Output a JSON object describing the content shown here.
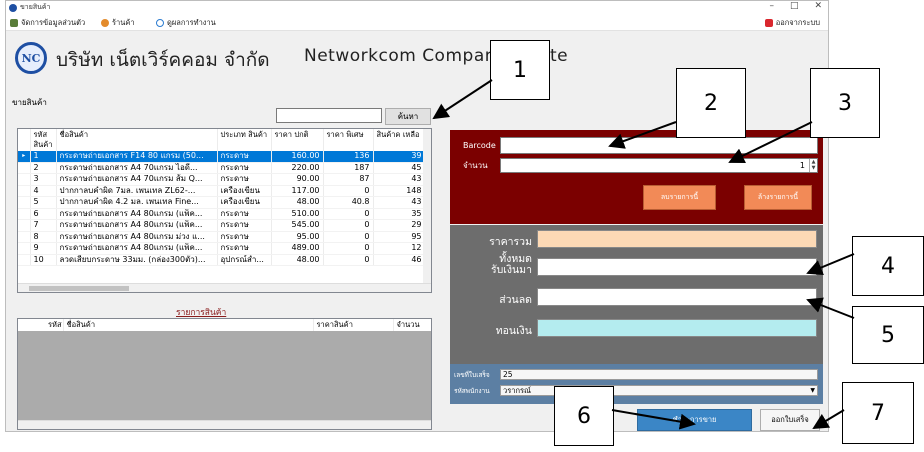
{
  "window": {
    "title": "ขายสินค้า",
    "controls": [
      "–",
      "□",
      "✕"
    ]
  },
  "menu": {
    "items": [
      "จัดการข้อมูลส่วนตัว",
      "ร้านค้า",
      "ดูผลการทำงาน"
    ],
    "logout": "ออกจากระบบ"
  },
  "company": {
    "logo_text": "NC",
    "name_th": "บริษัท เน็ตเวิร์คคอม จำกัด",
    "name_en": "Networkcom Company Limite"
  },
  "products": {
    "label": "ขายสินค้า",
    "search_button": "ค้นหา",
    "search_value": "",
    "columns": [
      "รหัส สินค้า",
      "ชื่อสินค้า",
      "ประเภท สินค้า",
      "ราคา ปกติ",
      "ราคา พิเศษ",
      "สินค้าค เหลือ"
    ],
    "rows": [
      [
        "1",
        "กระดาษถ่ายเอกสาร F14 80 แกรม (50...",
        "กระดาษ",
        "160.00",
        "136",
        "39"
      ],
      [
        "2",
        "กระดาษถ่ายเอกสาร A4 70แกรม ไอดี...",
        "กระดาษ",
        "220.00",
        "187",
        "45"
      ],
      [
        "3",
        "กระดาษถ่ายเอกสาร A4 70แกรม ส้ม Q...",
        "กระดาษ",
        "90.00",
        "87",
        "43"
      ],
      [
        "4",
        "ปากกาลบคำผิด 7มล. เพนเทล ZL62-...",
        "เครื่องเขียน",
        "117.00",
        "0",
        "148"
      ],
      [
        "5",
        "ปากกาลบคำผิด 4.2 มล. เพนเทล Fine...",
        "เครื่องเขียน",
        "48.00",
        "40.8",
        "43"
      ],
      [
        "6",
        "กระดาษถ่ายเอกสาร A4 80แกรม (แพ็ค...",
        "กระดาษ",
        "510.00",
        "0",
        "35"
      ],
      [
        "7",
        "กระดาษถ่ายเอกสาร A4 80แกรม (แพ็ค...",
        "กระดาษ",
        "545.00",
        "0",
        "29"
      ],
      [
        "8",
        "กระดาษถ่ายเอกสาร A4 80แกรม ม่วง แ...",
        "กระดาษ",
        "95.00",
        "0",
        "95"
      ],
      [
        "9",
        "กระดาษถ่ายเอกสาร A4 80แกรม (แพ็ค...",
        "กระดาษ",
        "489.00",
        "0",
        "12"
      ],
      [
        "10",
        "ลวดเสียบกระดาษ 33มม. (กล่อง300ตัว)...",
        "อุปกรณ์สำ...",
        "48.00",
        "0",
        "46"
      ]
    ]
  },
  "cart": {
    "label": "รายการสินค้า",
    "columns": [
      "รหัส",
      "ชื่อสินค้า",
      "ราคาสินค้า",
      "จำนวน"
    ]
  },
  "entry": {
    "barcode_label": "Barcode",
    "barcode_value": "",
    "qty_label": "จำนวน",
    "qty_value": "1",
    "delete_button": "ลบรายการนี้",
    "clear_button": "ล้างรายการนี้"
  },
  "totals": {
    "total_label": "ราคารวมทั้งหมด",
    "received_label": "รับเงินมา",
    "discount_label": "ส่วนลด",
    "change_label": "ทอนเงิน",
    "total_color": "#fdd9b5",
    "change_color": "#b4ecef"
  },
  "receipt": {
    "receipt_no_label": "เลขที่ใบเสร็จ",
    "receipt_no": "25",
    "employee_label": "รหัสพนักงาน",
    "employee": "วรากรณ์"
  },
  "actions": {
    "pay_button": "ชำระการขาย",
    "close_button": "ออกใบเสร็จ"
  },
  "callouts": [
    "1",
    "2",
    "3",
    "4",
    "5",
    "6",
    "7"
  ]
}
